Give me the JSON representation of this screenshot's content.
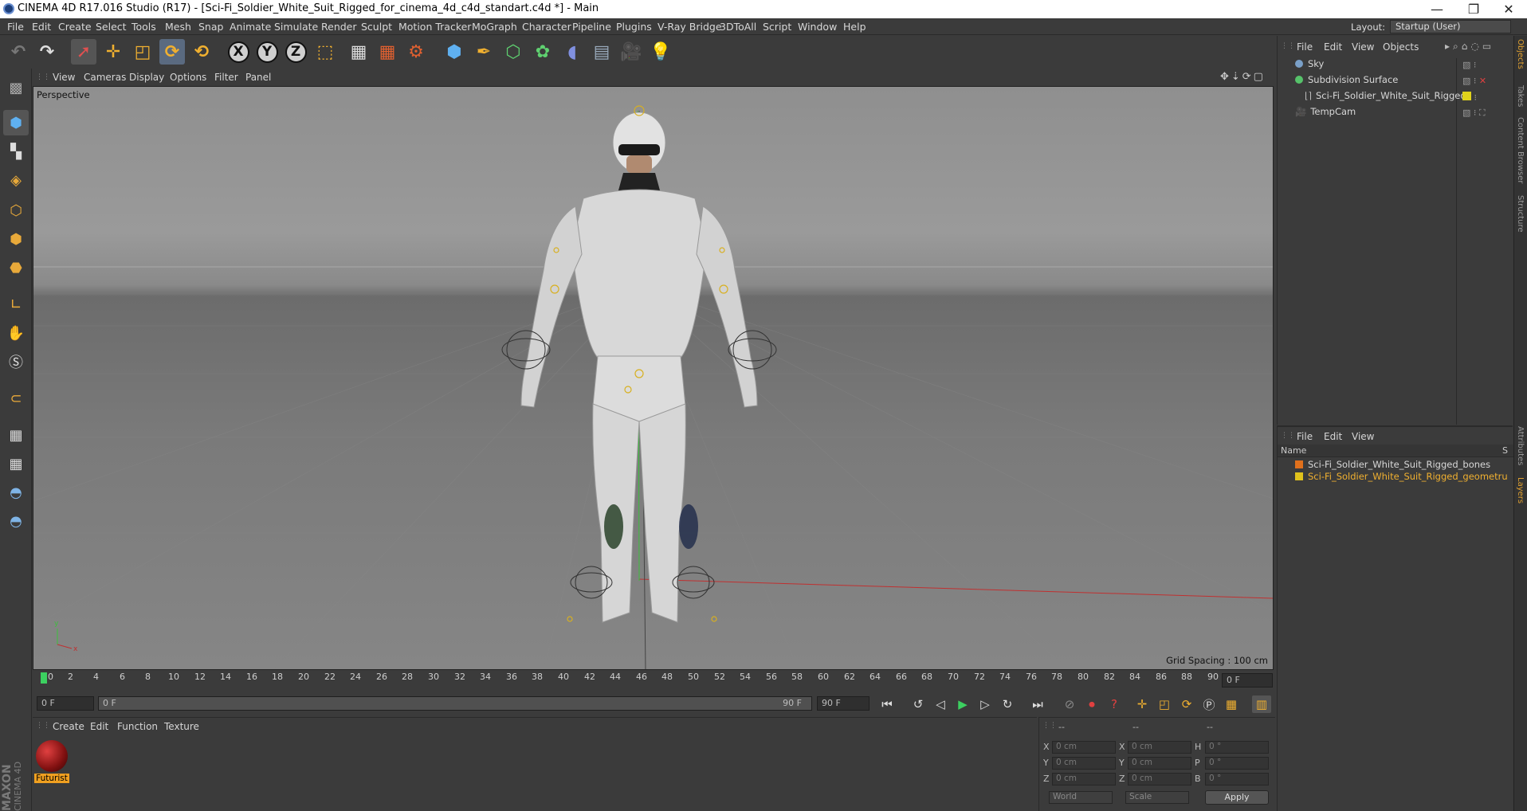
{
  "window": {
    "title": "CINEMA 4D R17.016 Studio (R17) - [Sci-Fi_Soldier_White_Suit_Rigged_for_cinema_4d_c4d_standart.c4d *] - Main",
    "minimize": "—",
    "restore": "❐",
    "close": "✕"
  },
  "menu": [
    "File",
    "Edit",
    "Create",
    "Select",
    "Tools",
    "Mesh",
    "Snap",
    "Animate",
    "Simulate",
    "Render",
    "Sculpt",
    "Motion Tracker",
    "MoGraph",
    "Character",
    "Pipeline",
    "Plugins",
    "V-Ray Bridge",
    "3DToAll",
    "Script",
    "Window",
    "Help"
  ],
  "layout": {
    "label": "Layout:",
    "value": "Startup (User)"
  },
  "viewport_menu": [
    "View",
    "Cameras",
    "Display",
    "Options",
    "Filter",
    "Panel"
  ],
  "viewport": {
    "label": "Perspective",
    "grid_spacing": "Grid Spacing : 100 cm"
  },
  "timeline": {
    "ticks": [
      "0",
      "2",
      "4",
      "6",
      "8",
      "10",
      "12",
      "14",
      "16",
      "18",
      "20",
      "22",
      "24",
      "26",
      "28",
      "30",
      "32",
      "34",
      "36",
      "38",
      "40",
      "42",
      "44",
      "46",
      "48",
      "50",
      "52",
      "54",
      "56",
      "58",
      "60",
      "62",
      "64",
      "66",
      "68",
      "70",
      "72",
      "74",
      "76",
      "78",
      "80",
      "82",
      "84",
      "86",
      "88",
      "90"
    ],
    "current_frame": "0 F"
  },
  "playbar": {
    "start": "0 F",
    "scrub_start": "0 F",
    "scrub_end": "90 F",
    "end": "90 F"
  },
  "material_menu": [
    "Create",
    "Edit",
    "Function",
    "Texture"
  ],
  "material": {
    "name": "Futurist"
  },
  "coords": {
    "header": [
      "--",
      "--",
      "--"
    ],
    "rows": [
      {
        "l1": "X",
        "v1": "0 cm",
        "l2": "X",
        "v2": "0 cm",
        "l3": "H",
        "v3": "0 °"
      },
      {
        "l1": "Y",
        "v1": "0 cm",
        "l2": "Y",
        "v2": "0 cm",
        "l3": "P",
        "v3": "0 °"
      },
      {
        "l1": "Z",
        "v1": "0 cm",
        "l2": "Z",
        "v2": "0 cm",
        "l3": "B",
        "v3": "0 °"
      }
    ],
    "mode": "World",
    "scale": "Scale",
    "apply": "Apply"
  },
  "objects_menu": [
    "File",
    "Edit",
    "View",
    "Objects"
  ],
  "objects": [
    {
      "name": "Sky",
      "color": "#7aa0c8"
    },
    {
      "name": "Subdivision Surface",
      "color": "#56c26a"
    },
    {
      "name": "Sci-Fi_Soldier_White_Suit_Rigged",
      "color": "#bbbbbb"
    },
    {
      "name": "TempCam",
      "color": "#dddddd"
    }
  ],
  "layers_menu": [
    "File",
    "Edit",
    "View"
  ],
  "layers": {
    "col_name": "Name",
    "col_s": "S",
    "items": [
      {
        "name": "Sci-Fi_Soldier_White_Suit_Rigged_bones",
        "color": "#e0701c"
      },
      {
        "name": "Sci-Fi_Soldier_White_Suit_Rigged_geometru",
        "color": "#e0c21c"
      }
    ]
  },
  "right_tabs": [
    "Objects",
    "Takes",
    "Content Browser",
    "Structure",
    "Attributes",
    "Layers"
  ],
  "brand": [
    "MAXON",
    "CINEMA 4D"
  ]
}
